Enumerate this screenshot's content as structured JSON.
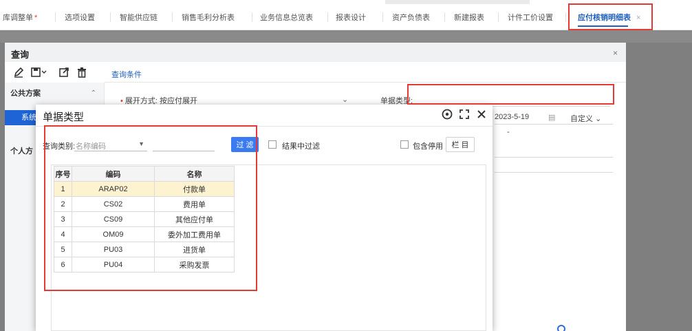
{
  "tabs": [
    {
      "label": "库调整单",
      "modified": true,
      "marker": "*"
    },
    {
      "label": "选项设置"
    },
    {
      "label": "智能供应链"
    },
    {
      "label": "销售毛利分析表"
    },
    {
      "label": "业务信息总览表"
    },
    {
      "label": "报表设计"
    },
    {
      "label": "资产负债表"
    },
    {
      "label": "新建报表"
    },
    {
      "label": "计件工价设置"
    },
    {
      "label": "应付核销明细表",
      "close": "×"
    }
  ],
  "query_dialog": {
    "title": "查询",
    "close": "×",
    "condition_tab": "查询条件",
    "left_panel": {
      "public_scheme": "公共方案",
      "selected_item": "系统",
      "personal_scheme": "个人方"
    },
    "fields": {
      "expand_label": "展开方式:",
      "expand_value": "按应付展开",
      "doc_type_label": "单据类型:",
      "date_value": "2023-5-19",
      "custom_label": "自定义",
      "dash": "-"
    }
  },
  "doc_type_dialog": {
    "title": "单据类型",
    "query_type_label": "查询类别:",
    "query_type_placeholder": "名称编码",
    "filter_button": "过 滤",
    "filter_in_results": "结果中过滤",
    "include_disabled": "包含停用",
    "columns_button": "栏 目",
    "table": {
      "headers": [
        "序号",
        "编码",
        "名称"
      ],
      "rows": [
        [
          "1",
          "ARAP02",
          "付款单"
        ],
        [
          "2",
          "CS02",
          "费用单"
        ],
        [
          "3",
          "CS09",
          "其他应付单"
        ],
        [
          "4",
          "OM09",
          "委外加工费用单"
        ],
        [
          "5",
          "PU03",
          "进货单"
        ],
        [
          "6",
          "PU04",
          "采购发票"
        ]
      ],
      "selected_row": 0
    }
  },
  "colors": {
    "accent": "#1f5fbf",
    "primary_button": "#3a7bf2",
    "annotation_red": "#e53935",
    "selected_row": "#fdf3d0"
  },
  "icons": [
    "edit-icon",
    "save-icon",
    "export-icon",
    "delete-icon",
    "help-icon",
    "maximize-icon",
    "close-icon",
    "calendar-icon",
    "chevron-down-icon"
  ]
}
